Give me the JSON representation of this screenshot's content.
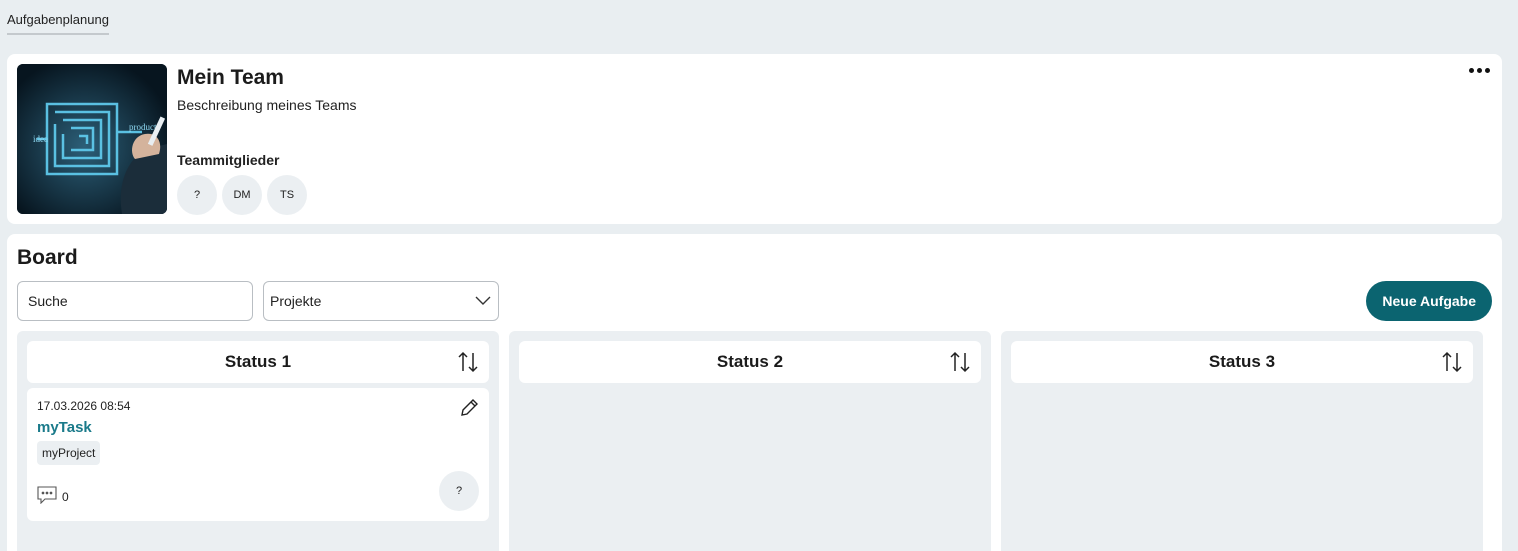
{
  "nav": {
    "tab_label": "Aufgabenplanung"
  },
  "team": {
    "title": "Mein Team",
    "description": "Beschreibung meines Teams",
    "members_label": "Teammitglieder",
    "members": [
      "?",
      "DM",
      "TS"
    ],
    "image_words": [
      "idea",
      "product"
    ]
  },
  "board": {
    "title": "Board",
    "search_value": "Suche",
    "projects_select": "Projekte",
    "new_task_label": "Neue Aufgabe",
    "columns": [
      {
        "title": "Status 1"
      },
      {
        "title": "Status 2"
      },
      {
        "title": "Status 3"
      }
    ],
    "task": {
      "date": "17.03.2026 08:54",
      "title": "myTask",
      "project": "myProject",
      "comments": "0",
      "assignee": "?"
    }
  },
  "colors": {
    "accent": "#0b6470",
    "link": "#1a7a8a",
    "background": "#e9eef1"
  }
}
